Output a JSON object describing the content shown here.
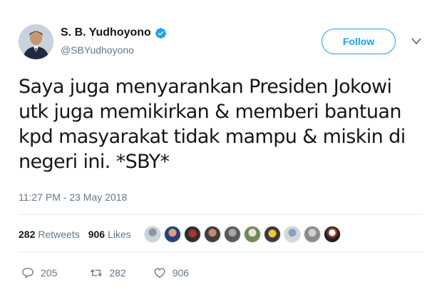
{
  "author": {
    "display_name": "S. B. Yudhoyono",
    "handle": "@SBYudhoyono",
    "verified_icon": "verified-badge-icon",
    "avatar_icon": "profile-avatar"
  },
  "follow_label": "Follow",
  "tweet_text": "Saya juga menyarankan Presiden Jokowi utk juga memikirkan & memberi bantuan kpd masyarakat tidak mampu & miskin di negeri ini. *SBY*",
  "timestamp": "11:27 PM - 23 May 2018",
  "stats": {
    "retweets_count": "282",
    "retweets_label": "Retweets",
    "likes_count": "906",
    "likes_label": "Likes"
  },
  "actions": {
    "reply_count": "205",
    "retweet_count": "282",
    "like_count": "906"
  },
  "colors": {
    "accent": "#1da1f2",
    "secondary_text": "#657786",
    "divider": "#e6ecf0"
  }
}
